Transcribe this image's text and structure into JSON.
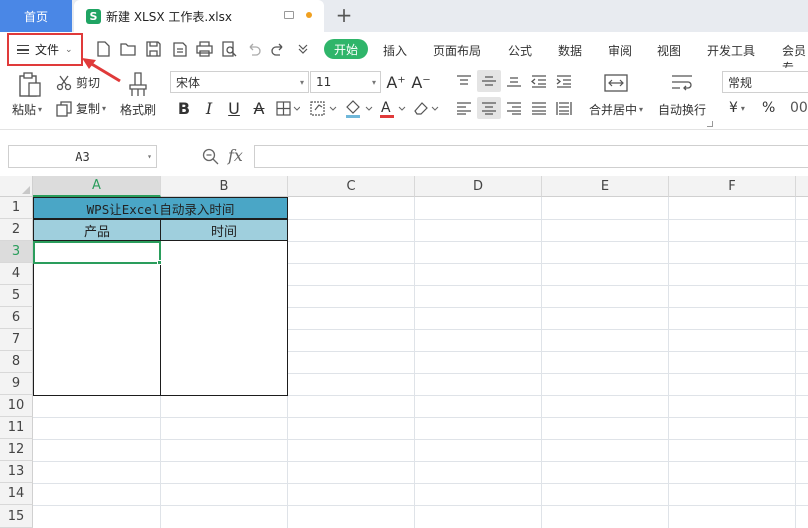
{
  "titlebar": {
    "home_tab": "首页",
    "doc_tab": "新建 XLSX 工作表.xlsx",
    "badge": "S",
    "new_tab": "+"
  },
  "menubar": {
    "file_label": "文件",
    "tabs": [
      "开始",
      "插入",
      "页面布局",
      "公式",
      "数据",
      "审阅",
      "视图",
      "开发工具",
      "会员专"
    ],
    "active_tab": "开始"
  },
  "ribbon": {
    "paste": "粘贴",
    "cut": "剪切",
    "copy": "复制",
    "format_painter": "格式刷",
    "font_name": "宋体",
    "font_size": "11",
    "merge_center": "合并居中",
    "wrap_text": "自动换行",
    "number_format": "常规",
    "currency": "¥",
    "percent": "%"
  },
  "formula_bar": {
    "name_box": "A3",
    "fx": "fx",
    "formula": ""
  },
  "sheet": {
    "columns": [
      "A",
      "B",
      "C",
      "D",
      "E",
      "F"
    ],
    "rows": [
      "1",
      "2",
      "3",
      "4",
      "5",
      "6",
      "7",
      "8",
      "9",
      "10",
      "11",
      "12",
      "13",
      "14",
      "15"
    ],
    "active_cell": "A3",
    "title": "WPS让Excel自动录入时间",
    "header_product": "产品",
    "header_time": "时间"
  },
  "colors": {
    "accent_green": "#2a9d5c",
    "home_blue": "#4a87e6",
    "title_fill": "#4aa6c6",
    "header_fill": "#9fcfdd",
    "annotation_red": "#e03a3a"
  }
}
